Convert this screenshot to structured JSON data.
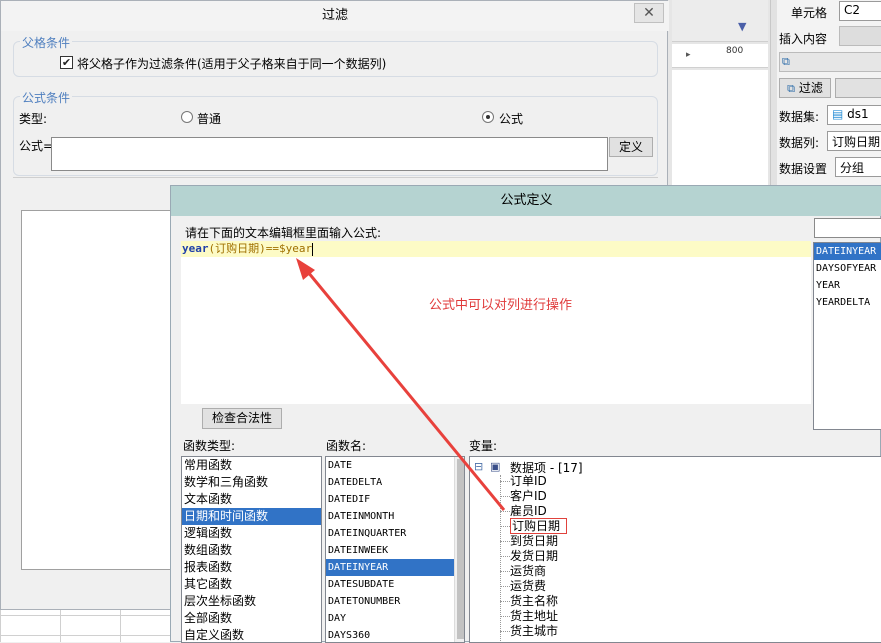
{
  "filter_dialog": {
    "title": "过滤",
    "close_glyph": "✕",
    "parent_condition": {
      "legend": "父格条件",
      "checkbox_label": "将父格子作为过滤条件(适用于父子格来自于同一个数据列)",
      "checked": true
    },
    "formula_condition": {
      "legend": "公式条件",
      "type_label": "类型:",
      "radio_normal": "普通",
      "radio_formula": "公式",
      "selected": "公式",
      "formula_label": "公式=",
      "define_button": "定义"
    }
  },
  "toolbar_ruler": {
    "value": "800"
  },
  "right_panel": {
    "cell_label": "单元格",
    "cell_value": "C2",
    "insert_label": "插入内容",
    "filter_button": "过滤",
    "dataset_label": "数据集:",
    "dataset_value": "ds1",
    "column_label": "数据列:",
    "column_value": "订购日期",
    "data_setting_label": "数据设置",
    "data_setting_value": "分组"
  },
  "formula_dialog": {
    "title": "公式定义",
    "prompt": "请在下面的文本编辑框里面输入公式:",
    "formula": {
      "func": "year",
      "open": "(",
      "arg": "订购日期",
      "close": ")",
      "op": "==",
      "var": "$year"
    },
    "annotation": "公式中可以对列进行操作",
    "check_button": "检查合法性",
    "func_type_label": "函数类型:",
    "func_name_label": "函数名:",
    "var_label": "变量:",
    "function_types": [
      "常用函数",
      "数学和三角函数",
      "文本函数",
      "日期和时间函数",
      "逻辑函数",
      "数组函数",
      "报表函数",
      "其它函数",
      "层次坐标函数",
      "全部函数",
      "自定义函数"
    ],
    "function_types_selected": 3,
    "function_names": [
      "DATE",
      "DATEDELTA",
      "DATEDIF",
      "DATEINMONTH",
      "DATEINQUARTER",
      "DATEINWEEK",
      "DATEINYEAR",
      "DATESUBDATE",
      "DATETONUMBER",
      "DAY",
      "DAYS360"
    ],
    "function_names_selected": 6,
    "search_results": [
      "DATEINYEAR",
      "DAYSOFYEAR",
      "YEAR",
      "YEARDELTA"
    ],
    "search_results_selected": 0,
    "tree_root": "数据项 - [17]",
    "tree_root_toggle": "⊟",
    "variables": [
      "订单ID",
      "客户ID",
      "雇员ID",
      "订购日期",
      "到货日期",
      "发货日期",
      "运货商",
      "运货费",
      "货主名称",
      "货主地址",
      "货主城市"
    ],
    "variables_highlighted": 3
  },
  "colors": {
    "accent_select": "#3173c6",
    "formula_func": "#1f3fa8",
    "formula_arg": "#a07000",
    "annotation": "#e03a3a",
    "arrow": "#e8413c",
    "title_bar": "#b5d3d1"
  }
}
